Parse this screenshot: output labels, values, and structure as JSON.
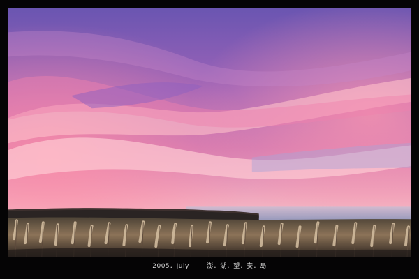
{
  "photo": {
    "subject": "sunset sky over grassland and sea",
    "colors": {
      "sky_top": "#6f55b0",
      "sky_mid": "#b56ab8",
      "glow": "#f08fae",
      "horizon": "#f6b7c1",
      "sea": "#a9b6d6",
      "land": "#2a2423",
      "grass": "#b99a7a"
    }
  },
  "caption": {
    "date": "2005．July",
    "place": "澎．湖．望．安．島"
  }
}
